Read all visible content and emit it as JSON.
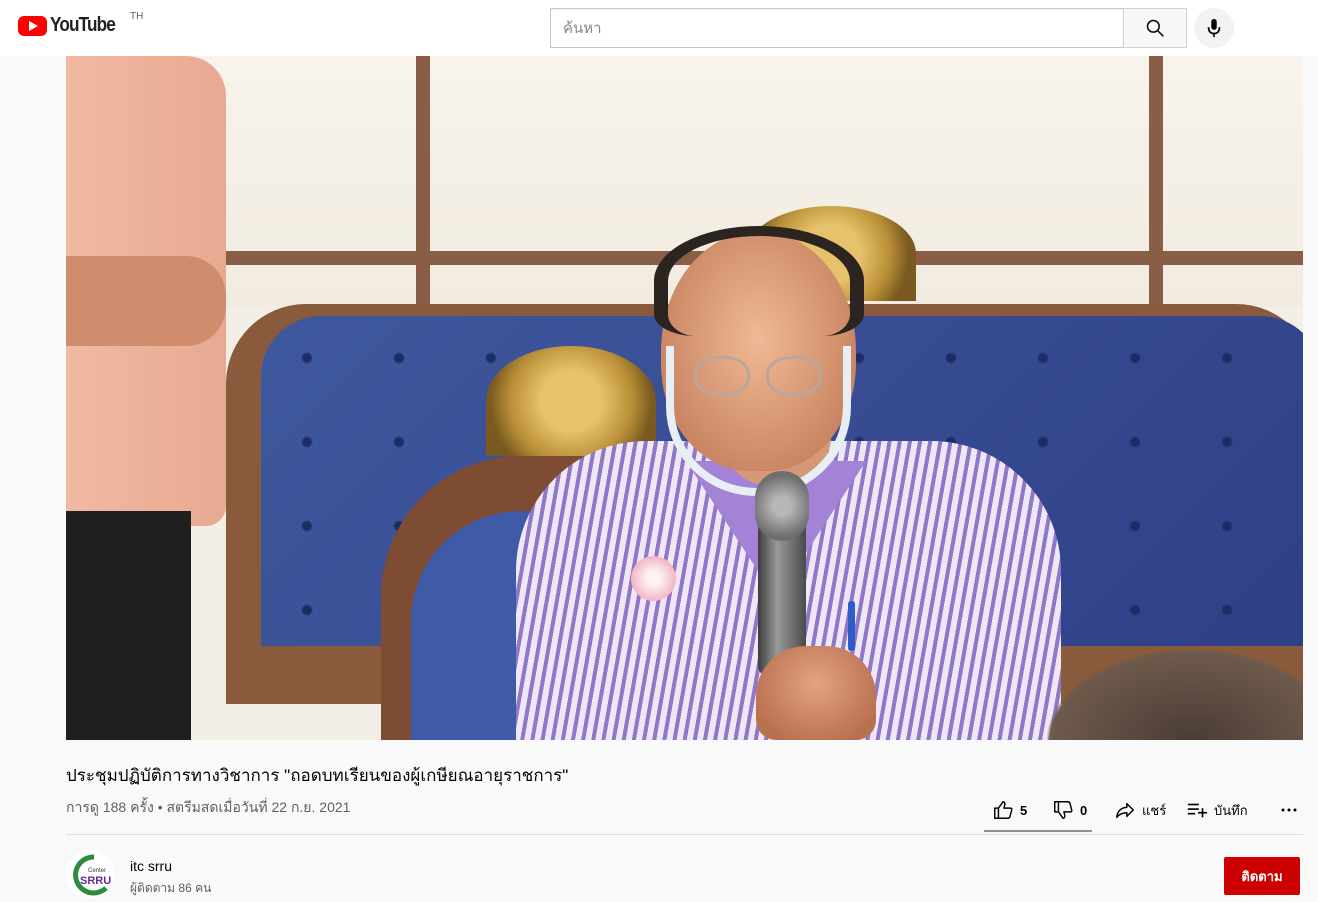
{
  "masthead": {
    "logo_text": "YouTube",
    "country_code": "TH",
    "search_placeholder": "ค้นหา",
    "brand_color": "#ff0000"
  },
  "video": {
    "title": "ประชุมปฏิบัติการทางวิชาการ \"ถอดบทเรียนของผู้เกษียณอายุราชการ\"",
    "meta": "การดู 188 ครั้ง • สตรีมสดเมื่อวันที่ 22 ก.ย. 2021"
  },
  "actions": {
    "like_count": "5",
    "dislike_count": "0",
    "share_label": "แชร์",
    "save_label": "บันทึก",
    "icons": [
      "thumb-up-icon",
      "thumb-down-icon",
      "share-icon",
      "playlist-add-icon",
      "more-icon"
    ]
  },
  "channel": {
    "name": "itc srru",
    "subscribers": "ผู้ติดตาม 86 คน",
    "avatar_top_text": "Center",
    "avatar_main_text": "SRRU",
    "subscribe_label": "ติดตาม",
    "subscribe_color": "#cc0000"
  }
}
